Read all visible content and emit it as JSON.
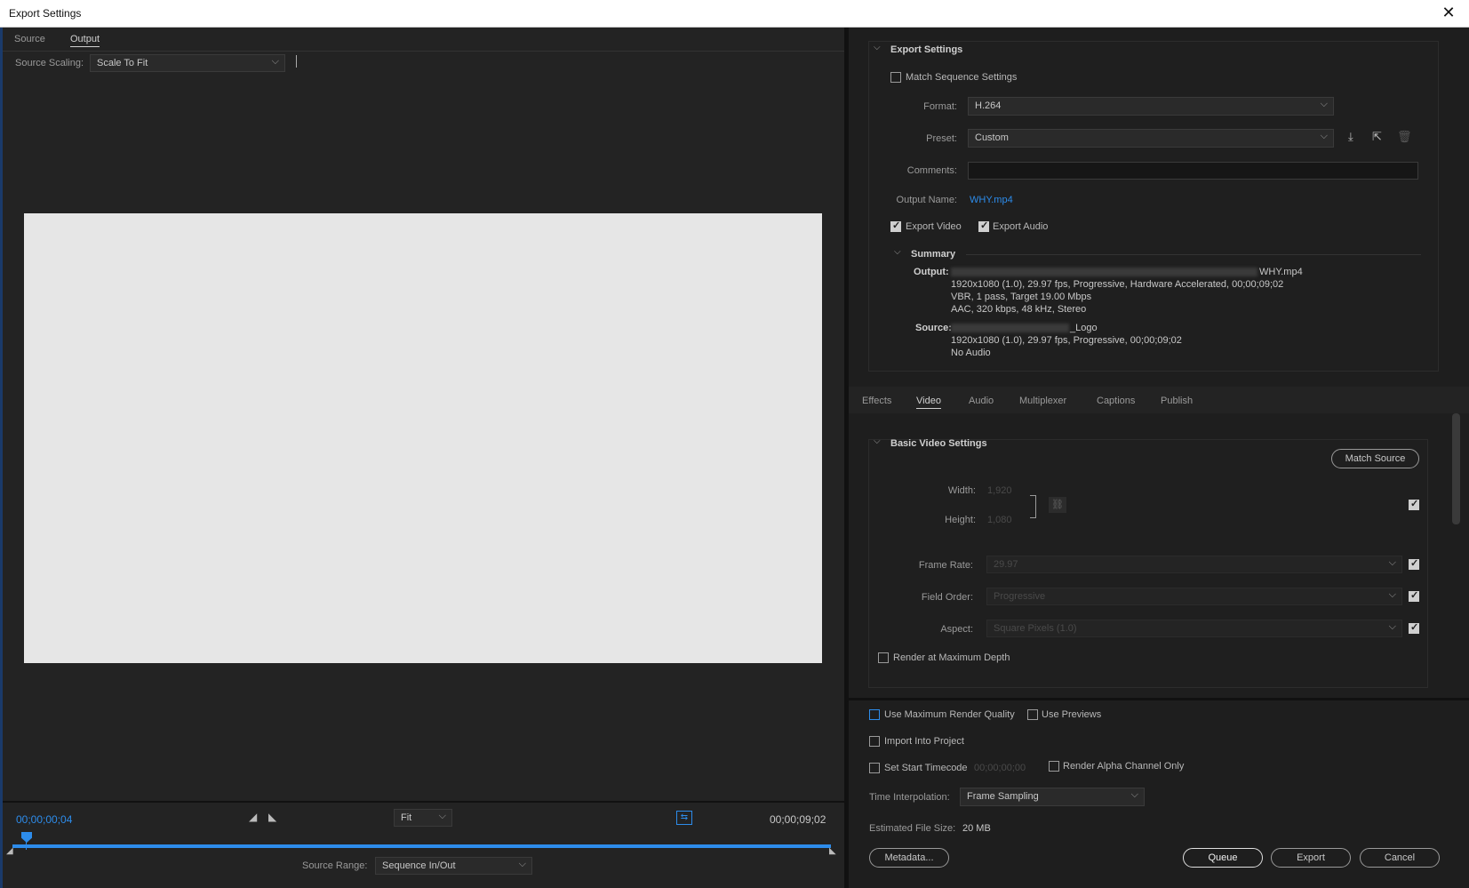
{
  "window": {
    "title": "Export Settings"
  },
  "left": {
    "tabs": [
      "Source",
      "Output"
    ],
    "source_scaling_label": "Source Scaling:",
    "source_scaling_value": "Scale To Fit",
    "timecode_current": "00;00;00;04",
    "timecode_end": "00;00;09;02",
    "zoom_value": "Fit",
    "source_range_label": "Source Range:",
    "source_range_value": "Sequence In/Out"
  },
  "export_settings": {
    "title": "Export Settings",
    "match_sequence": "Match Sequence Settings",
    "format_label": "Format:",
    "format_value": "H.264",
    "preset_label": "Preset:",
    "preset_value": "Custom",
    "comments_label": "Comments:",
    "comments_value": "",
    "output_name_label": "Output Name:",
    "output_name_value": "WHY.mp4",
    "export_video": "Export Video",
    "export_audio": "Export Audio",
    "summary": {
      "title": "Summary",
      "output_label": "Output:",
      "output_file": "WHY.mp4",
      "output_lines": [
        "1920x1080 (1.0), 29.97 fps, Progressive, Hardware Accelerated, 00;00;09;02",
        "VBR, 1 pass, Target 19.00 Mbps",
        "AAC, 320 kbps, 48 kHz, Stereo"
      ],
      "source_label": "Source:",
      "source_name": "_Logo",
      "source_lines": [
        "1920x1080 (1.0), 29.97 fps, Progressive, 00;00;09;02",
        "No Audio"
      ]
    }
  },
  "tabs2": [
    "Effects",
    "Video",
    "Audio",
    "Multiplexer",
    "Captions",
    "Publish"
  ],
  "video": {
    "title": "Basic Video Settings",
    "match_source": "Match Source",
    "width_label": "Width:",
    "width_value": "1,920",
    "height_label": "Height:",
    "height_value": "1,080",
    "frame_rate_label": "Frame Rate:",
    "frame_rate_value": "29.97",
    "field_order_label": "Field Order:",
    "field_order_value": "Progressive",
    "aspect_label": "Aspect:",
    "aspect_value": "Square Pixels (1.0)",
    "render_max_depth": "Render at Maximum Depth"
  },
  "bottom": {
    "use_max_render": "Use Maximum Render Quality",
    "use_previews": "Use Previews",
    "import_into_project": "Import Into Project",
    "set_start_timecode": "Set Start Timecode",
    "start_timecode_value": "00;00;00;00",
    "render_alpha": "Render Alpha Channel Only",
    "time_interp_label": "Time Interpolation:",
    "time_interp_value": "Frame Sampling",
    "est_size_label": "Estimated File Size:",
    "est_size_value": "20 MB",
    "metadata": "Metadata...",
    "queue": "Queue",
    "export": "Export",
    "cancel": "Cancel"
  },
  "colors": {
    "accent": "#2d8ceb",
    "panel": "#1e1e1e",
    "preview": "#e6e6e6"
  }
}
